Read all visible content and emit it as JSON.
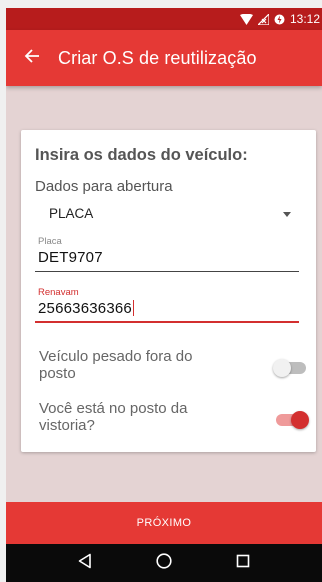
{
  "status_bar": {
    "time": "13:12"
  },
  "app_bar": {
    "title": "Criar O.S de reutilização"
  },
  "card": {
    "title": "Insira os dados do veículo:",
    "section_label": "Dados para abertura",
    "select": {
      "selected": "PLACA"
    },
    "fields": [
      {
        "label": "Placa",
        "value": "DET9707"
      },
      {
        "label": "Renavam",
        "value": "25663636366"
      }
    ],
    "toggles": [
      {
        "label": "Veículo pesado fora do posto",
        "checked": false
      },
      {
        "label": "Você está no posto da vistoria?",
        "checked": true
      }
    ]
  },
  "footer": {
    "next_label": "PRÓXIMO"
  },
  "icons": {
    "wifi": "wifi-icon",
    "signal": "signal-off-icon",
    "battery": "battery-charging-icon",
    "back": "arrow-back-icon",
    "nav_back": "triangle-back-icon",
    "nav_home": "circle-home-icon",
    "nav_recents": "square-recents-icon"
  },
  "colors": {
    "primary": "#e53935",
    "status_bar": "#b71c1c",
    "accent": "#d32f2f",
    "background": "#e4d3d3"
  }
}
